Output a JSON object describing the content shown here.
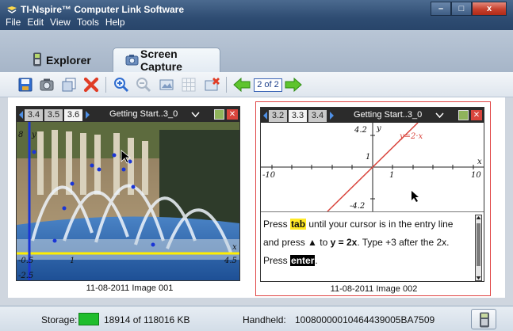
{
  "window": {
    "title": "TI-Nspire™ Computer Link Software",
    "minimize": "–",
    "maximize": "□",
    "close": "x"
  },
  "menu": [
    "File",
    "Edit",
    "View",
    "Tools",
    "Help"
  ],
  "tabs": {
    "explorer": "Explorer",
    "screen_capture": "Screen Capture",
    "active": "screen_capture"
  },
  "toolbar": {
    "page_indicator": "2 of 2"
  },
  "captures": [
    {
      "caption": "11-08-2011 Image 001",
      "page_tabs": [
        "3.4",
        "3.5",
        "3.6"
      ],
      "active_tab": "3.6",
      "doc_title": "Getting Start..3_0",
      "axis_labels": {
        "ymax": "8",
        "y": "y",
        "xmin": "-0.5",
        "xmid": "1",
        "xmax": "4.5",
        "x": "x",
        "ymin": "-2.5"
      },
      "selected": false
    },
    {
      "caption": "11-08-2011 Image 002",
      "page_tabs": [
        "3.2",
        "3.3",
        "3.4"
      ],
      "active_tab": "3.3",
      "doc_title": "Getting Start..3_0",
      "graph": {
        "ymax": "4.2",
        "y": "y",
        "function": "y=2·x",
        "y1": "1",
        "xmin": "-10",
        "xone": "1",
        "xmax": "10",
        "x": "x",
        "ymin": "-4.2"
      },
      "text": {
        "press1": "Press",
        "tab_key": "tab",
        "line1_rest": "until your cursor is in the entry line",
        "line2_a": "and press ▲ to",
        "line2_eq": "y = 2x",
        "line2_b": ". Type +3 after the 2x.",
        "press2": "Press",
        "enter_key": "enter",
        "period": "."
      },
      "selected": true
    }
  ],
  "status": {
    "storage_label": "Storage:",
    "storage_value": "18914 of 118016 KB",
    "handheld_label": "Handheld:",
    "handheld_id": "10080000010464439005BA7509"
  },
  "colors": {
    "titlebar": "#2e4c72",
    "selection_border": "#e04545",
    "storage_green": "#1fbd2c",
    "fit_line": "#ffee00",
    "data_point": "#1a35d6"
  }
}
